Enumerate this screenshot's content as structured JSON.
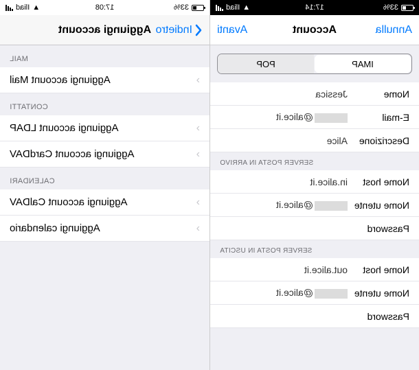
{
  "left": {
    "status": {
      "carrier": "Iliad",
      "battery": "33%",
      "time": "17:14"
    },
    "nav": {
      "cancel": "Annulla",
      "title": "Account",
      "next": "Avanti"
    },
    "segmented": {
      "imap": "IMAP",
      "pop": "POP"
    },
    "fields": {
      "name_label": "Nome",
      "name_value": "Jessica",
      "email_label": "E-mail",
      "email_suffix": "@alice.it",
      "desc_label": "Descrizione",
      "desc_value": "Alice"
    },
    "incoming_header": "SERVER POSTA IN ARRIVO",
    "incoming": {
      "host_label": "Nome host",
      "host_value": "in.alice.it",
      "user_label": "Nome utente",
      "user_suffix": "@alice.it",
      "pass_label": "Password"
    },
    "outgoing_header": "SERVER POSTA IN USCITA",
    "outgoing": {
      "host_label": "Nome host",
      "host_value": "out.alice.it",
      "user_label": "Nome utente",
      "user_suffix": "@alice.it",
      "pass_label": "Password"
    }
  },
  "right": {
    "status": {
      "carrier": "Iliad",
      "battery": "33%",
      "time": "17:08"
    },
    "nav": {
      "back": "Indietro",
      "title": "Aggiungi account"
    },
    "mail_header": "MAIL",
    "mail_item": "Aggiungi account Mail",
    "contacts_header": "CONTATTI",
    "contacts_ldap": "Aggiungi account LDAP",
    "contacts_carddav": "Aggiungi account CardDAV",
    "cal_header": "CALENDARI",
    "cal_caldav": "Aggiungi account CalDAV",
    "cal_sub": "Aggiungi calendario"
  }
}
